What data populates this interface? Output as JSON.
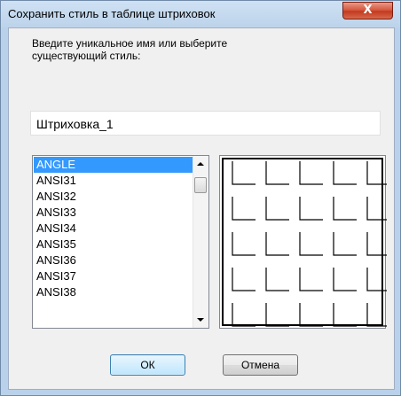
{
  "window": {
    "title": "Сохранить стиль в таблице штриховок",
    "close_label": "X"
  },
  "prompt": {
    "line1": "Введите уникальное имя или выберите",
    "line2": "существующий стиль:"
  },
  "name_input": {
    "value": "Штриховка_1"
  },
  "list": {
    "items": [
      "ANGLE",
      "ANSI31",
      "ANSI32",
      "ANSI33",
      "ANSI34",
      "ANSI35",
      "ANSI36",
      "ANSI37",
      "ANSI38"
    ],
    "selected": "ANGLE"
  },
  "buttons": {
    "ok": "ОК",
    "cancel": "Отмена"
  },
  "colors": {
    "selection": "#3399ff",
    "dialog_bg": "#f0f0f0",
    "frame": "#b9d1ea",
    "close": "#c23a1f"
  }
}
